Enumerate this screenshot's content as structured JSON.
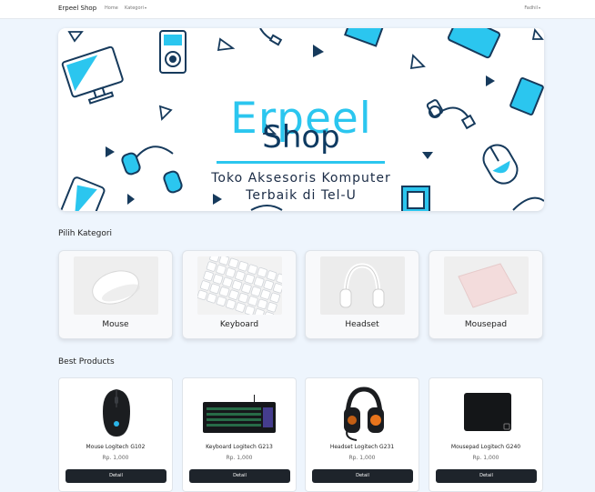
{
  "navbar": {
    "brand": "Erpeel Shop",
    "links": [
      "Home",
      "Kategori"
    ],
    "user": "Fadhil"
  },
  "hero": {
    "title_1": "Erpeel",
    "title_2": "Shop",
    "subtitle_1": "Toko Aksesoris Komputer",
    "subtitle_2": "Terbaik di Tel-U"
  },
  "categories_section": {
    "title": "Pilih Kategori",
    "items": [
      {
        "label": "Mouse"
      },
      {
        "label": "Keyboard"
      },
      {
        "label": "Headset"
      },
      {
        "label": "Mousepad"
      }
    ]
  },
  "products_section": {
    "title": "Best Products",
    "items": [
      {
        "name": "Mouse Logitech G102",
        "price": "Rp. 1,000",
        "button": "Detail"
      },
      {
        "name": "Keyboard Logitech G213",
        "price": "Rp. 1,000",
        "button": "Detail"
      },
      {
        "name": "Headset Logitech G231",
        "price": "Rp. 1,000",
        "button": "Detail"
      },
      {
        "name": "Mousepad Logitech G240",
        "price": "Rp. 1,000",
        "button": "Detail"
      }
    ]
  },
  "colors": {
    "accent": "#2bc6ef",
    "navy": "#0e3a61",
    "button": "#1e242b",
    "background": "#eef5fd"
  }
}
